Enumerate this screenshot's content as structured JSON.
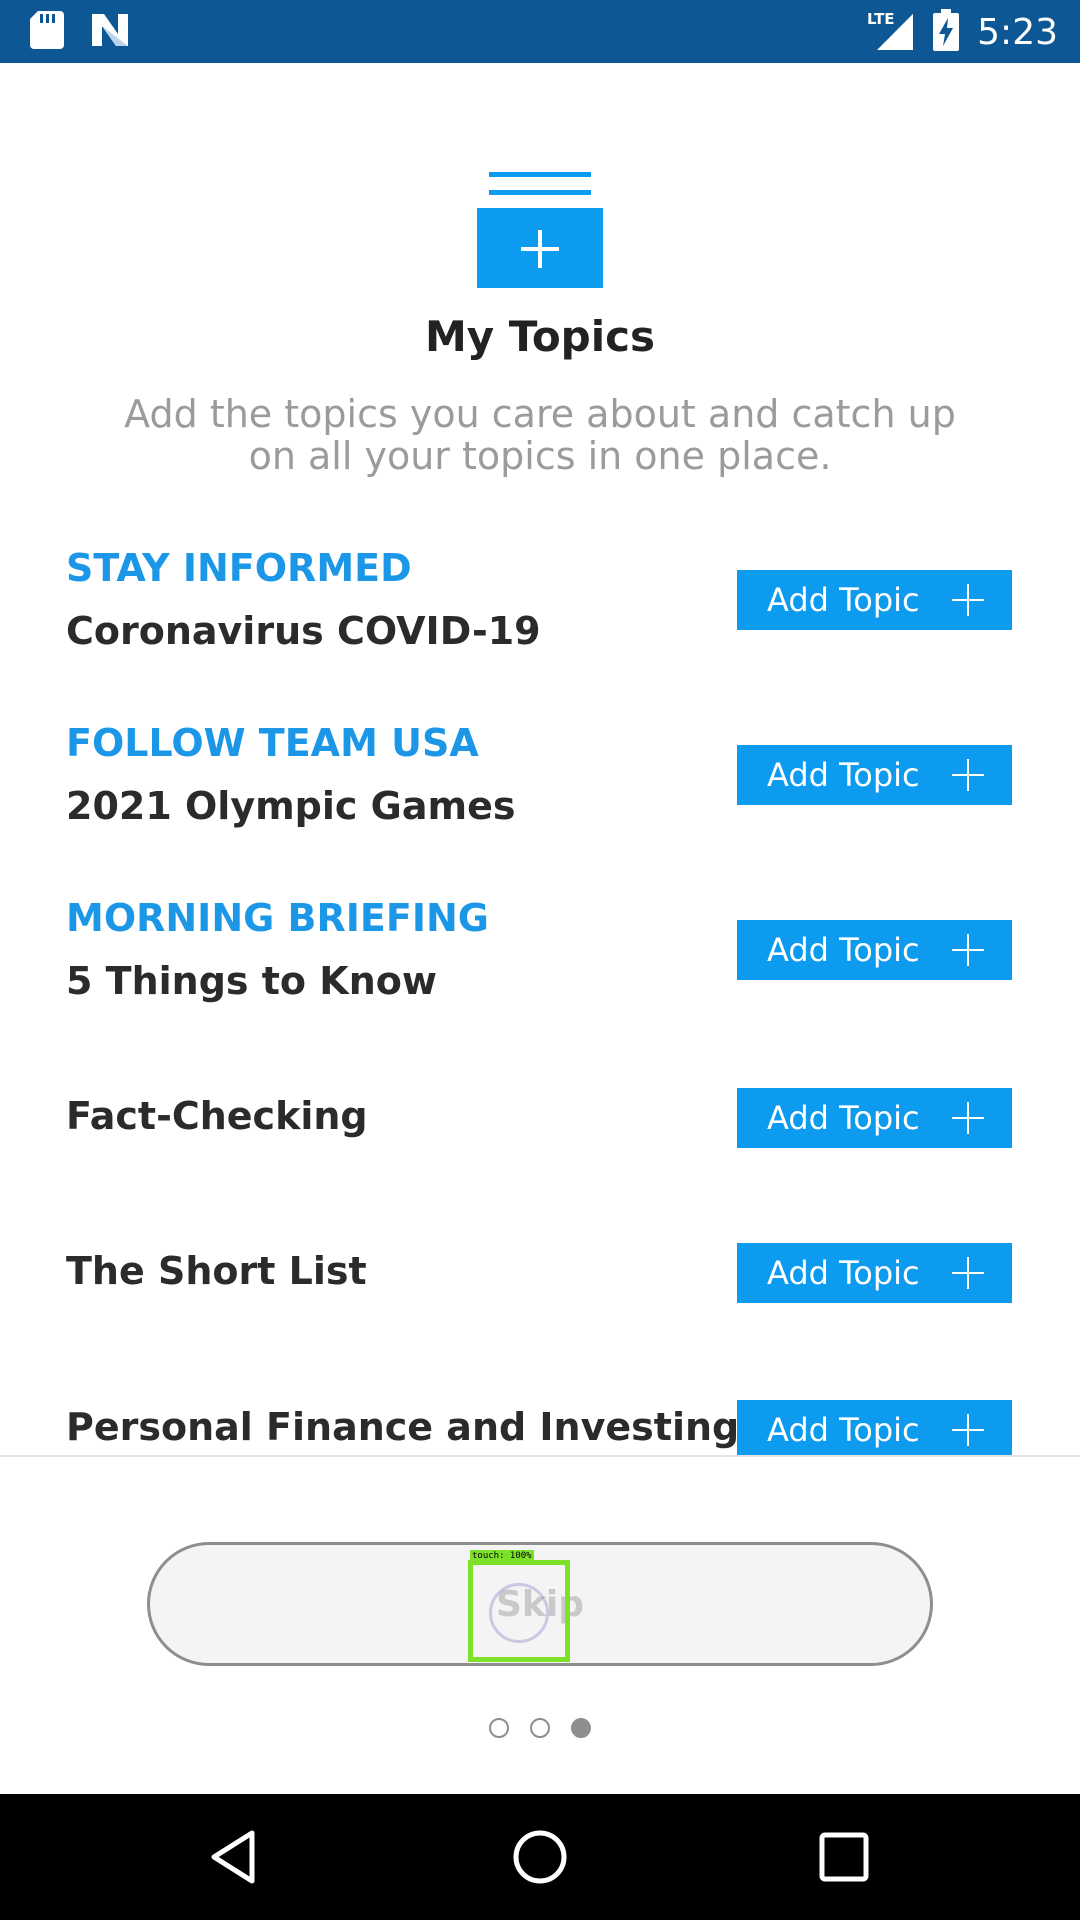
{
  "status_bar": {
    "time": "5:23",
    "left_icons": [
      "sd-card-icon",
      "n-logo-icon"
    ],
    "right_icons": [
      "lte-signal-icon",
      "battery-charging-icon"
    ]
  },
  "header": {
    "icon": "add-topic-folder-icon",
    "title": "My Topics",
    "subtitle": "Add the topics you care about and catch up on all your topics in one place."
  },
  "topics": [
    {
      "kicker": "STAY INFORMED",
      "name": "Coronavirus COVID-19",
      "button": "Add Topic"
    },
    {
      "kicker": "FOLLOW TEAM USA",
      "name": "2021 Olympic Games",
      "button": "Add Topic"
    },
    {
      "kicker": "MORNING BRIEFING",
      "name": "5 Things to Know",
      "button": "Add Topic"
    },
    {
      "kicker": "",
      "name": "Fact-Checking",
      "button": "Add Topic"
    },
    {
      "kicker": "",
      "name": "The Short List",
      "button": "Add Topic"
    },
    {
      "kicker": "",
      "name": "Personal Finance and Investing",
      "button": "Add Topic"
    }
  ],
  "footer": {
    "skip_label": "Skip",
    "touch_tag": "touch: 100%",
    "page_indicator": {
      "total": 3,
      "active": 3
    }
  },
  "colors": {
    "status_bar": "#0e5795",
    "accent": "#0d9bf0",
    "kicker": "#1c97e8"
  },
  "nav_bar": {
    "buttons": [
      "back-icon",
      "home-icon",
      "recents-icon"
    ]
  }
}
